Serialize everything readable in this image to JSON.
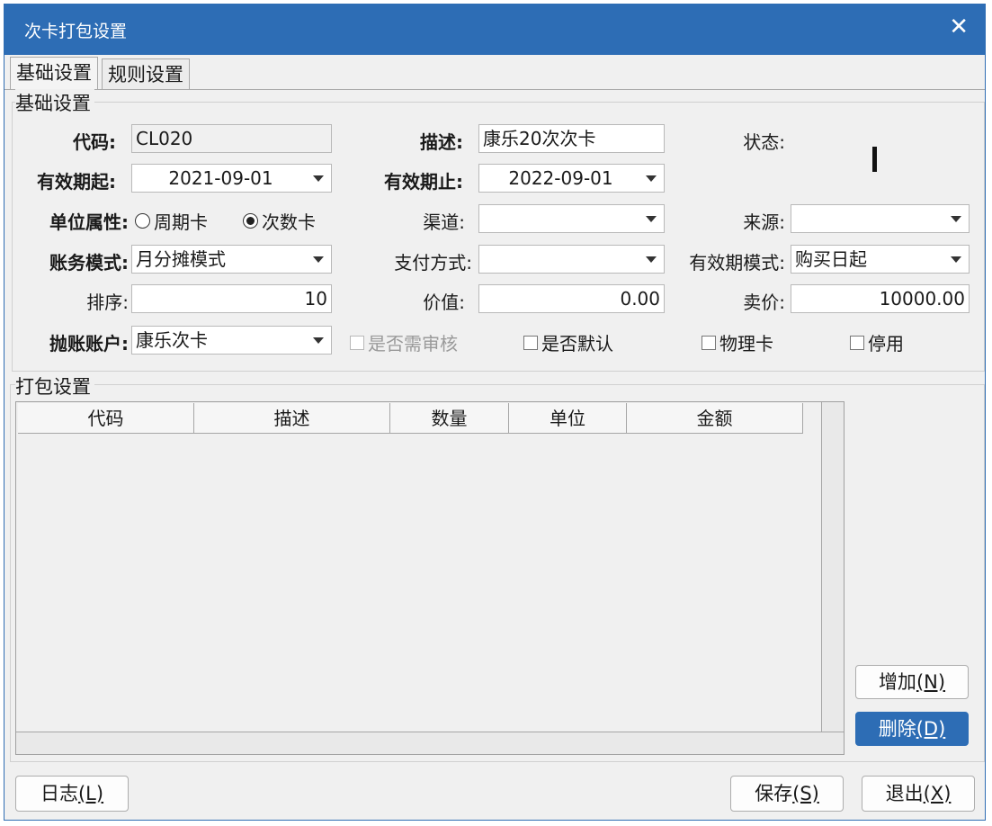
{
  "window": {
    "title": "次卡打包设置",
    "close_glyph": "✕"
  },
  "tabs": [
    {
      "label": "基础设置"
    },
    {
      "label": "规则设置"
    }
  ],
  "basic": {
    "group_label": "基础设置",
    "code": {
      "label": "代码:",
      "value": "CL020"
    },
    "desc": {
      "label": "描述:",
      "value": "康乐20次次卡"
    },
    "status": {
      "label": "状态:"
    },
    "valid_from": {
      "label": "有效期起:",
      "value": "2021-09-01"
    },
    "valid_to": {
      "label": "有效期止:",
      "value": "2022-09-01"
    },
    "unit_attr": {
      "label": "单位属性:",
      "options": [
        {
          "label": "周期卡",
          "selected": false
        },
        {
          "label": "次数卡",
          "selected": true
        }
      ]
    },
    "channel": {
      "label": "渠道:",
      "value": ""
    },
    "source": {
      "label": "来源:",
      "value": ""
    },
    "account_mode": {
      "label": "账务模式:",
      "value": "月分摊模式"
    },
    "pay_method": {
      "label": "支付方式:",
      "value": ""
    },
    "valid_mode": {
      "label": "有效期模式:",
      "value": "购买日起"
    },
    "sort": {
      "label": "排序:",
      "value": "10"
    },
    "worth": {
      "label": "价值:",
      "value": "0.00"
    },
    "price": {
      "label": "卖价:",
      "value": "10000.00"
    },
    "account": {
      "label": "抛账账户:",
      "value": "康乐次卡"
    },
    "checks": [
      {
        "label": "是否需审核",
        "checked": false,
        "disabled": true
      },
      {
        "label": "是否默认",
        "checked": false,
        "disabled": false
      },
      {
        "label": "物理卡",
        "checked": false,
        "disabled": false
      },
      {
        "label": "停用",
        "checked": false,
        "disabled": false
      }
    ]
  },
  "package": {
    "group_label": "打包设置",
    "columns": [
      "代码",
      "描述",
      "数量",
      "单位",
      "金额"
    ],
    "add_button": {
      "label": "增加",
      "key": "(N)"
    },
    "delete_button": {
      "label": "删除",
      "key": "(D)"
    }
  },
  "footer": {
    "log_button": {
      "label": "日志",
      "key": "(L)"
    },
    "save_button": {
      "label": "保存",
      "key": "(S)"
    },
    "exit_button": {
      "label": "退出",
      "key": "(X)"
    }
  },
  "colors": {
    "accent": "#2d6db5",
    "background": "#f0f0f0"
  }
}
